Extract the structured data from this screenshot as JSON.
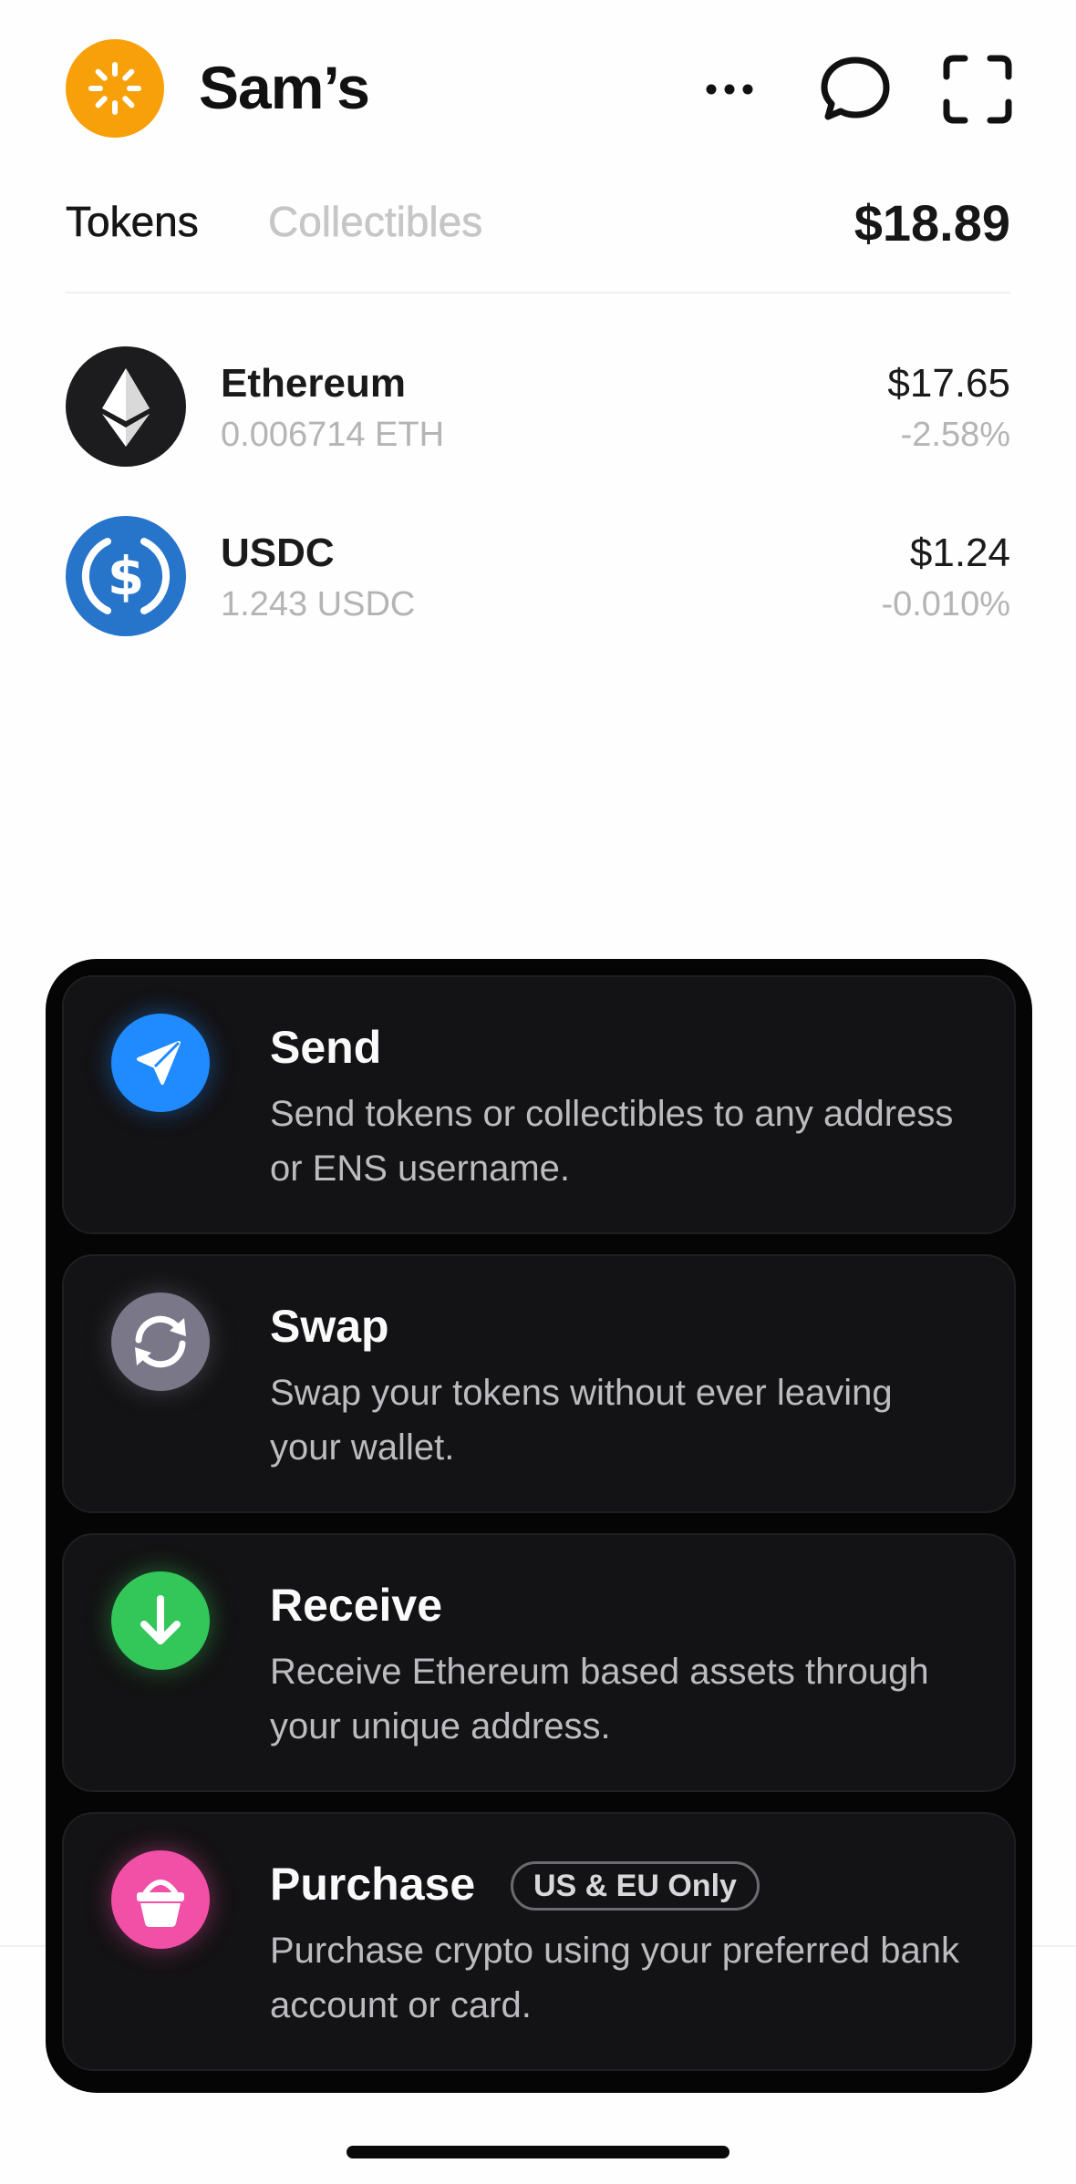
{
  "header": {
    "wallet_name": "Sam’s",
    "avatar_color": "#f7a009",
    "icons": [
      "more-icon",
      "chat-bubble-icon",
      "scan-icon"
    ]
  },
  "tabs": {
    "tokens_label": "Tokens",
    "collectibles_label": "Collectibles",
    "total_balance": "$18.89"
  },
  "tokens": [
    {
      "name": "Ethereum",
      "amount": "0.006714 ETH",
      "value": "$17.65",
      "change": "-2.58%",
      "icon": "ethereum-icon",
      "color": "#1c1c1e"
    },
    {
      "name": "USDC",
      "amount": "1.243 USDC",
      "value": "$1.24",
      "change": "-0.010%",
      "icon": "usdc-icon",
      "color": "#2775ca"
    }
  ],
  "actions": {
    "send": {
      "title": "Send",
      "description": "Send tokens or collectibles to any address or ENS username.",
      "color": "#1f8bff"
    },
    "swap": {
      "title": "Swap",
      "description": "Swap your tokens without ever leaving your wallet.",
      "color": "#7a7789"
    },
    "receive": {
      "title": "Receive",
      "description": "Receive Ethereum based assets through your unique address.",
      "color": "#33c759"
    },
    "purchase": {
      "title": "Purchase",
      "badge": "US & EU Only",
      "description": "Purchase crypto using your preferred bank account or card.",
      "color": "#f24fa7"
    }
  }
}
